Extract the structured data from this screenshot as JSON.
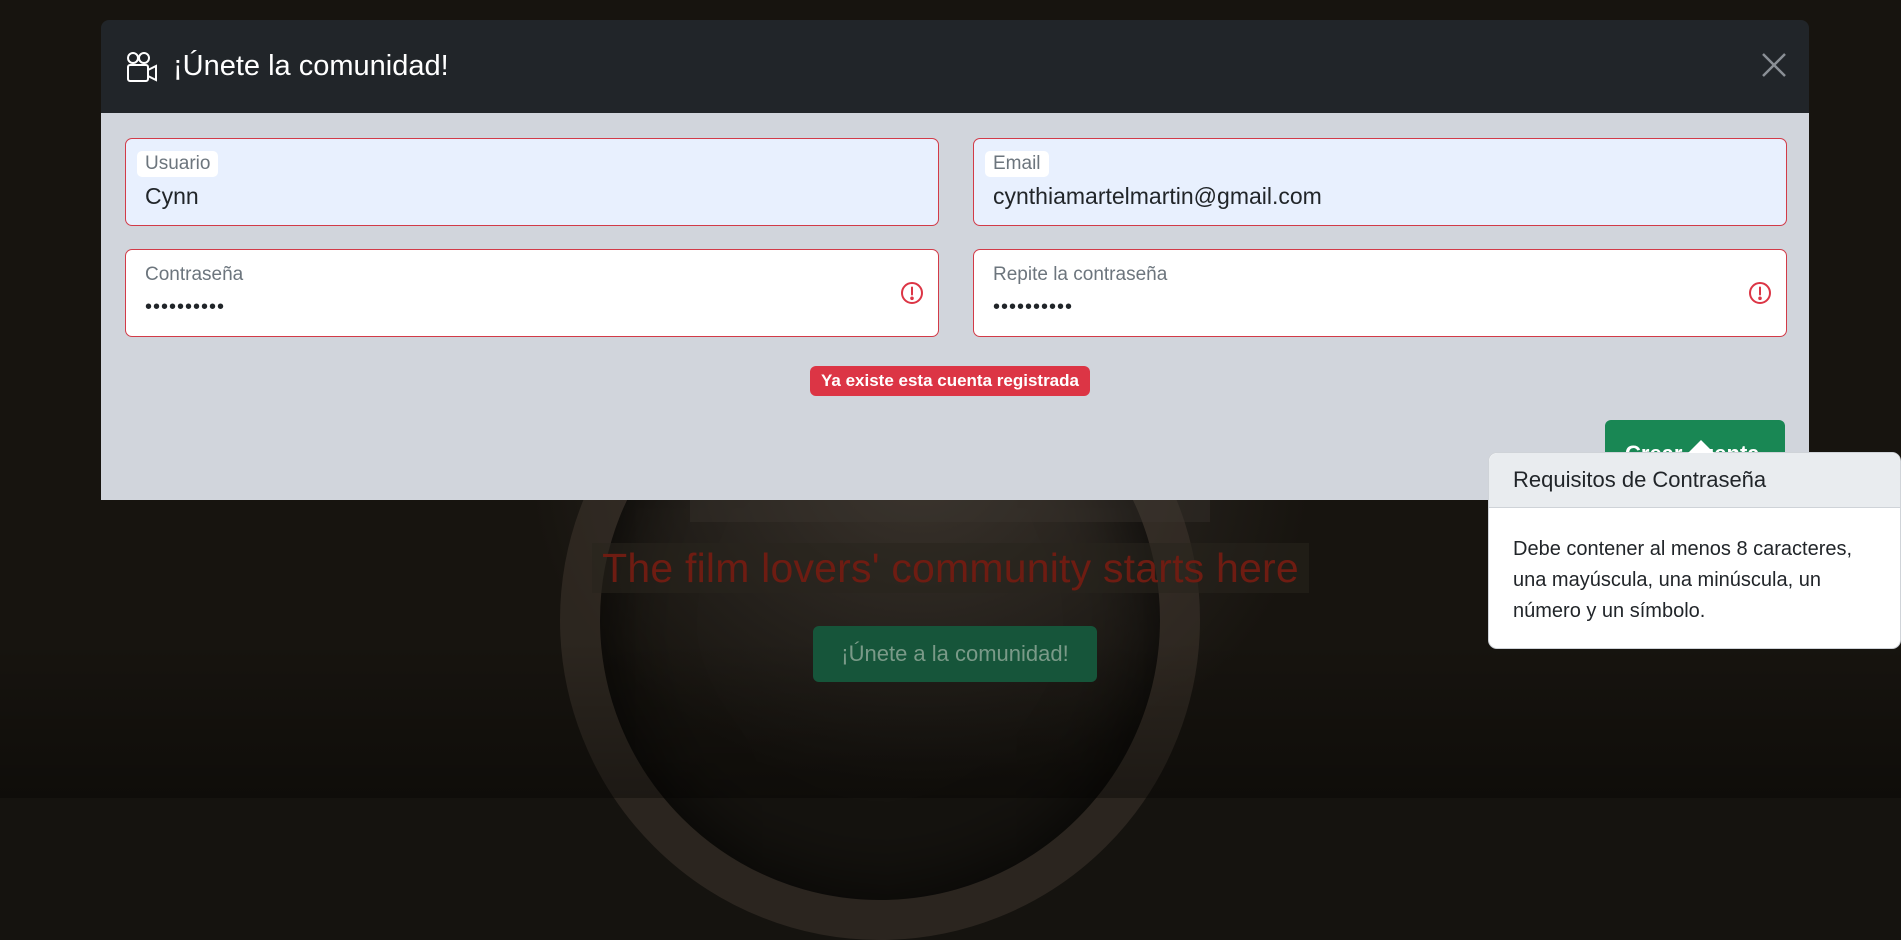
{
  "modal": {
    "title": "¡Únete la comunidad!",
    "icon": "video-camera-icon",
    "close_icon": "close-icon",
    "fields": {
      "username": {
        "label": "Usuario",
        "value": "Cynn"
      },
      "email": {
        "label": "Email",
        "value": "cynthiamartelmartin@gmail.com"
      },
      "password": {
        "label": "Contraseña",
        "value": "••••••••••"
      },
      "repeat_password": {
        "label": "Repite la contraseña",
        "value": "••••••••••"
      }
    },
    "error_message": "Ya existe esta cuenta registrada",
    "submit_label": "Crear cuenta"
  },
  "popover": {
    "title": "Requisitos de Contraseña",
    "body": "Debe contener al menos 8 caracteres, una mayúscula, una minúscula, un número y un símbolo."
  },
  "hero": {
    "tagline": "The film lovers' community starts here",
    "cta_label": "¡Únete a la comunidad!"
  },
  "colors": {
    "danger": "#dc3545",
    "success": "#198754",
    "header_bg": "#212529",
    "body_bg": "#d1d5dc"
  }
}
